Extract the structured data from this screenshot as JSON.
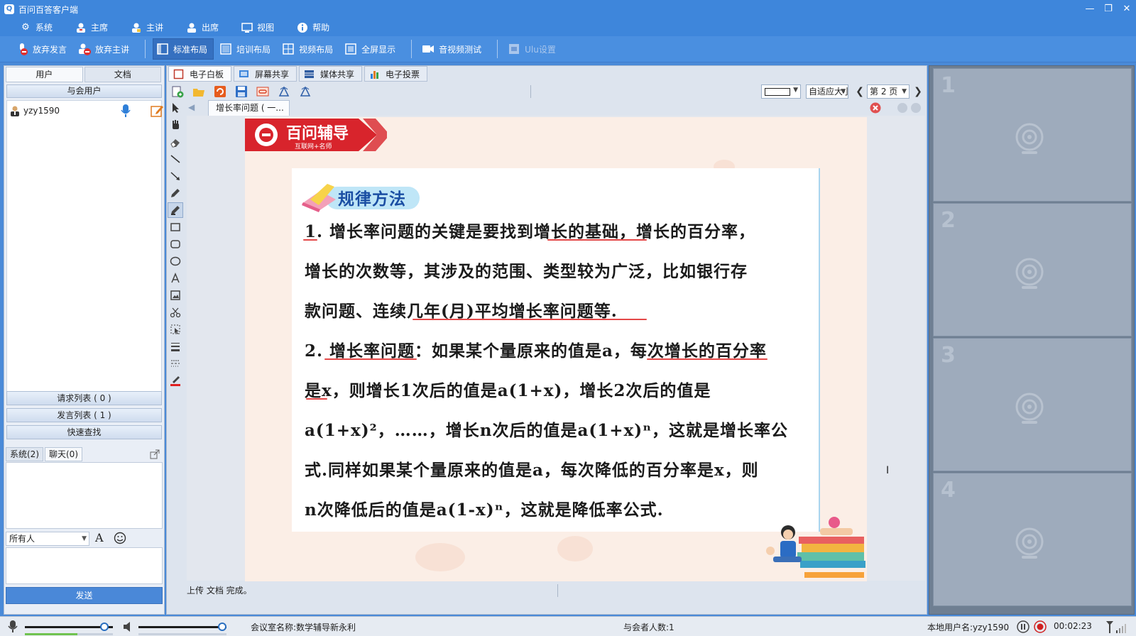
{
  "window": {
    "title": "百问百答客户端",
    "app_icon": "Q",
    "controls": [
      "—",
      "❐",
      "✕"
    ]
  },
  "menu": [
    {
      "label": "系统",
      "icon": "gear-icon"
    },
    {
      "label": "主席",
      "icon": "chair-user-icon"
    },
    {
      "label": "主讲",
      "icon": "speaker-user-icon"
    },
    {
      "label": "出席",
      "icon": "attendee-icon"
    },
    {
      "label": "视图",
      "icon": "monitor-icon"
    },
    {
      "label": "帮助",
      "icon": "info-icon"
    }
  ],
  "toolbar": {
    "give_up_speak": "放弃发言",
    "give_up_lecture": "放弃主讲",
    "standard_layout": "标准布局",
    "training_layout": "培训布局",
    "video_layout": "视频布局",
    "fullscreen": "全屏显示",
    "av_test": "音视频测试",
    "disabled_item": "Ulu设置"
  },
  "left": {
    "tab_users": "用户",
    "tab_docs": "文档",
    "participants_header": "与会用户",
    "users": [
      {
        "name": "yzy1590"
      }
    ],
    "request_list": "请求列表 ( 0 )",
    "speak_list": "发言列表 ( 1 )",
    "quick_search": "快速查找",
    "chat_tab_system": "系统(2)",
    "chat_tab_chat": "聊天(0)",
    "recipient": "所有人",
    "font_button": "A",
    "send": "发送"
  },
  "center": {
    "tabs": [
      "电子白板",
      "屏幕共享",
      "媒体共享",
      "电子投票"
    ],
    "zoom": "自适应大小",
    "page": "第 2 页",
    "doc_tab": "增长率问题 ( 一...",
    "status": "上传 文档 完成。",
    "slide": {
      "logo_main": "百问辅导",
      "logo_sub": "互联网+名师",
      "section_title": "规律方法",
      "lines": [
        "1. 增长率问题的关键是要找到增长的基础，增长的百分率，",
        "增长的次数等，其涉及的范围、类型较为广泛，比如银行存",
        "款问题、连续几年(月)平均增长率问题等.",
        "2. 增长率问题：如果某个量原来的值是a，每次增长的百分率",
        "是x，则增长1次后的值是a(1+x)，增长2次后的值是",
        "a(1+x)²，……，增长n次后的值是a(1+x)ⁿ，这就是增长率公",
        "式.同样如果某个量原来的值是a，每次降低的百分率是x，则",
        "n次降低后的值是a(1-x)ⁿ，这就是降低率公式."
      ]
    }
  },
  "right": {
    "slots": [
      "1",
      "2",
      "3",
      "4"
    ]
  },
  "bottom": {
    "room": "会议室名称:数学辅导新永利",
    "attendees": "与会者人数:1",
    "local_user": "本地用户名:yzy1590",
    "timer": "00:02:23",
    "mic_volume": 0.95,
    "speaker_volume": 1.0,
    "mic_level": 0.6
  },
  "colors": {
    "title_blue": "#3e86db",
    "underline_red": "#e44848",
    "badge_blue": "#1a4ea3"
  }
}
